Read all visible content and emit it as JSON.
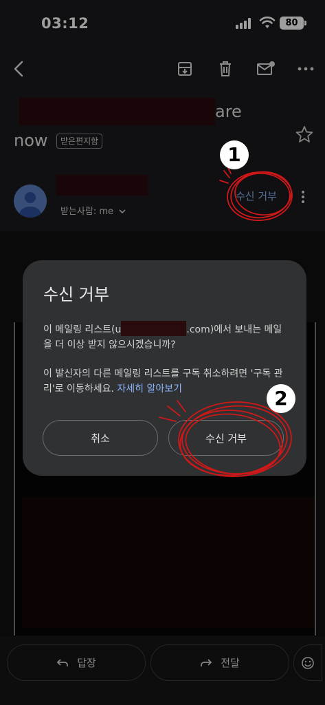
{
  "status_bar": {
    "time": "03:12",
    "battery": "80"
  },
  "toolbar": {
    "back_icon": "back-arrow-icon",
    "archive_icon": "archive-icon",
    "delete_icon": "trash-icon",
    "unread_icon": "mark-unread-icon",
    "more_icon": "more-horizontal-icon"
  },
  "message": {
    "subject_tail": "are",
    "subject_line2": "now",
    "label_chip": "받은편지함",
    "recipient": "받는사람: me",
    "unsubscribe_link": "수신 거부"
  },
  "dialog": {
    "title": "수신 거부",
    "body1_pre": "이 메일링 리스트(u",
    "body1_post": ".com)에서 보내는 메일을 더 이상 받지 않으시겠습니까?",
    "body2": "이 발신자의 다른 메일링 리스트를 구독 취소하려면 '구독 관리'로 이동하세요. ",
    "learn_more": "자세히 알아보기",
    "cancel_label": "취소",
    "confirm_label": "수신 거부"
  },
  "bottom_bar": {
    "reply_label": "답장",
    "forward_label": "전달"
  },
  "annotations": {
    "step1": "1",
    "step2": "2",
    "color": "#d01818"
  },
  "colors": {
    "link": "#8ab4f8",
    "dialog_bg": "#2f3133",
    "redaction": "#2a0b0d"
  }
}
